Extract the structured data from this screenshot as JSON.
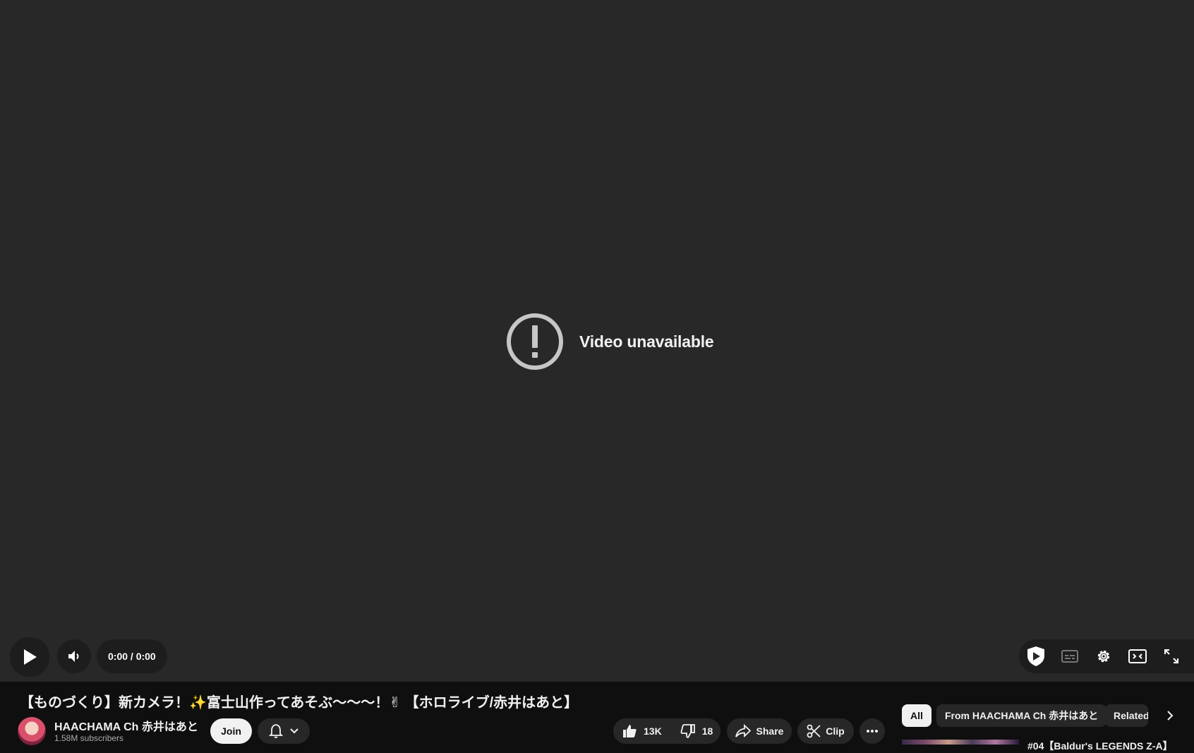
{
  "player": {
    "error_message": "Video unavailable",
    "time_display": "0:00 / 0:00"
  },
  "video": {
    "title": "【ものづくり】新カメラ！✨富士山作ってあそぶ〜〜〜！✌ 【ホロライブ/赤井はあと】"
  },
  "channel": {
    "name": "HAACHAMA Ch 赤井はあと",
    "subscribers": "1.58M subscribers",
    "join_label": "Join"
  },
  "actions": {
    "like_count": "13K",
    "dislike_count": "18",
    "share_label": "Share",
    "clip_label": "Clip"
  },
  "chips": [
    {
      "label": "All",
      "active": true
    },
    {
      "label": "From HAACHAMA Ch 赤井はあと",
      "active": false
    },
    {
      "label": "Related",
      "active": false
    }
  ],
  "recommendations": {
    "first_title_partial": "#04【Baldur's LEGENDS Z-A】"
  },
  "colors": {
    "player_bg": "#282828",
    "page_bg": "#0f0f0f",
    "text": "#f1f1f1",
    "secondary_text": "#aaaaaa",
    "button_bg": "#272727"
  }
}
